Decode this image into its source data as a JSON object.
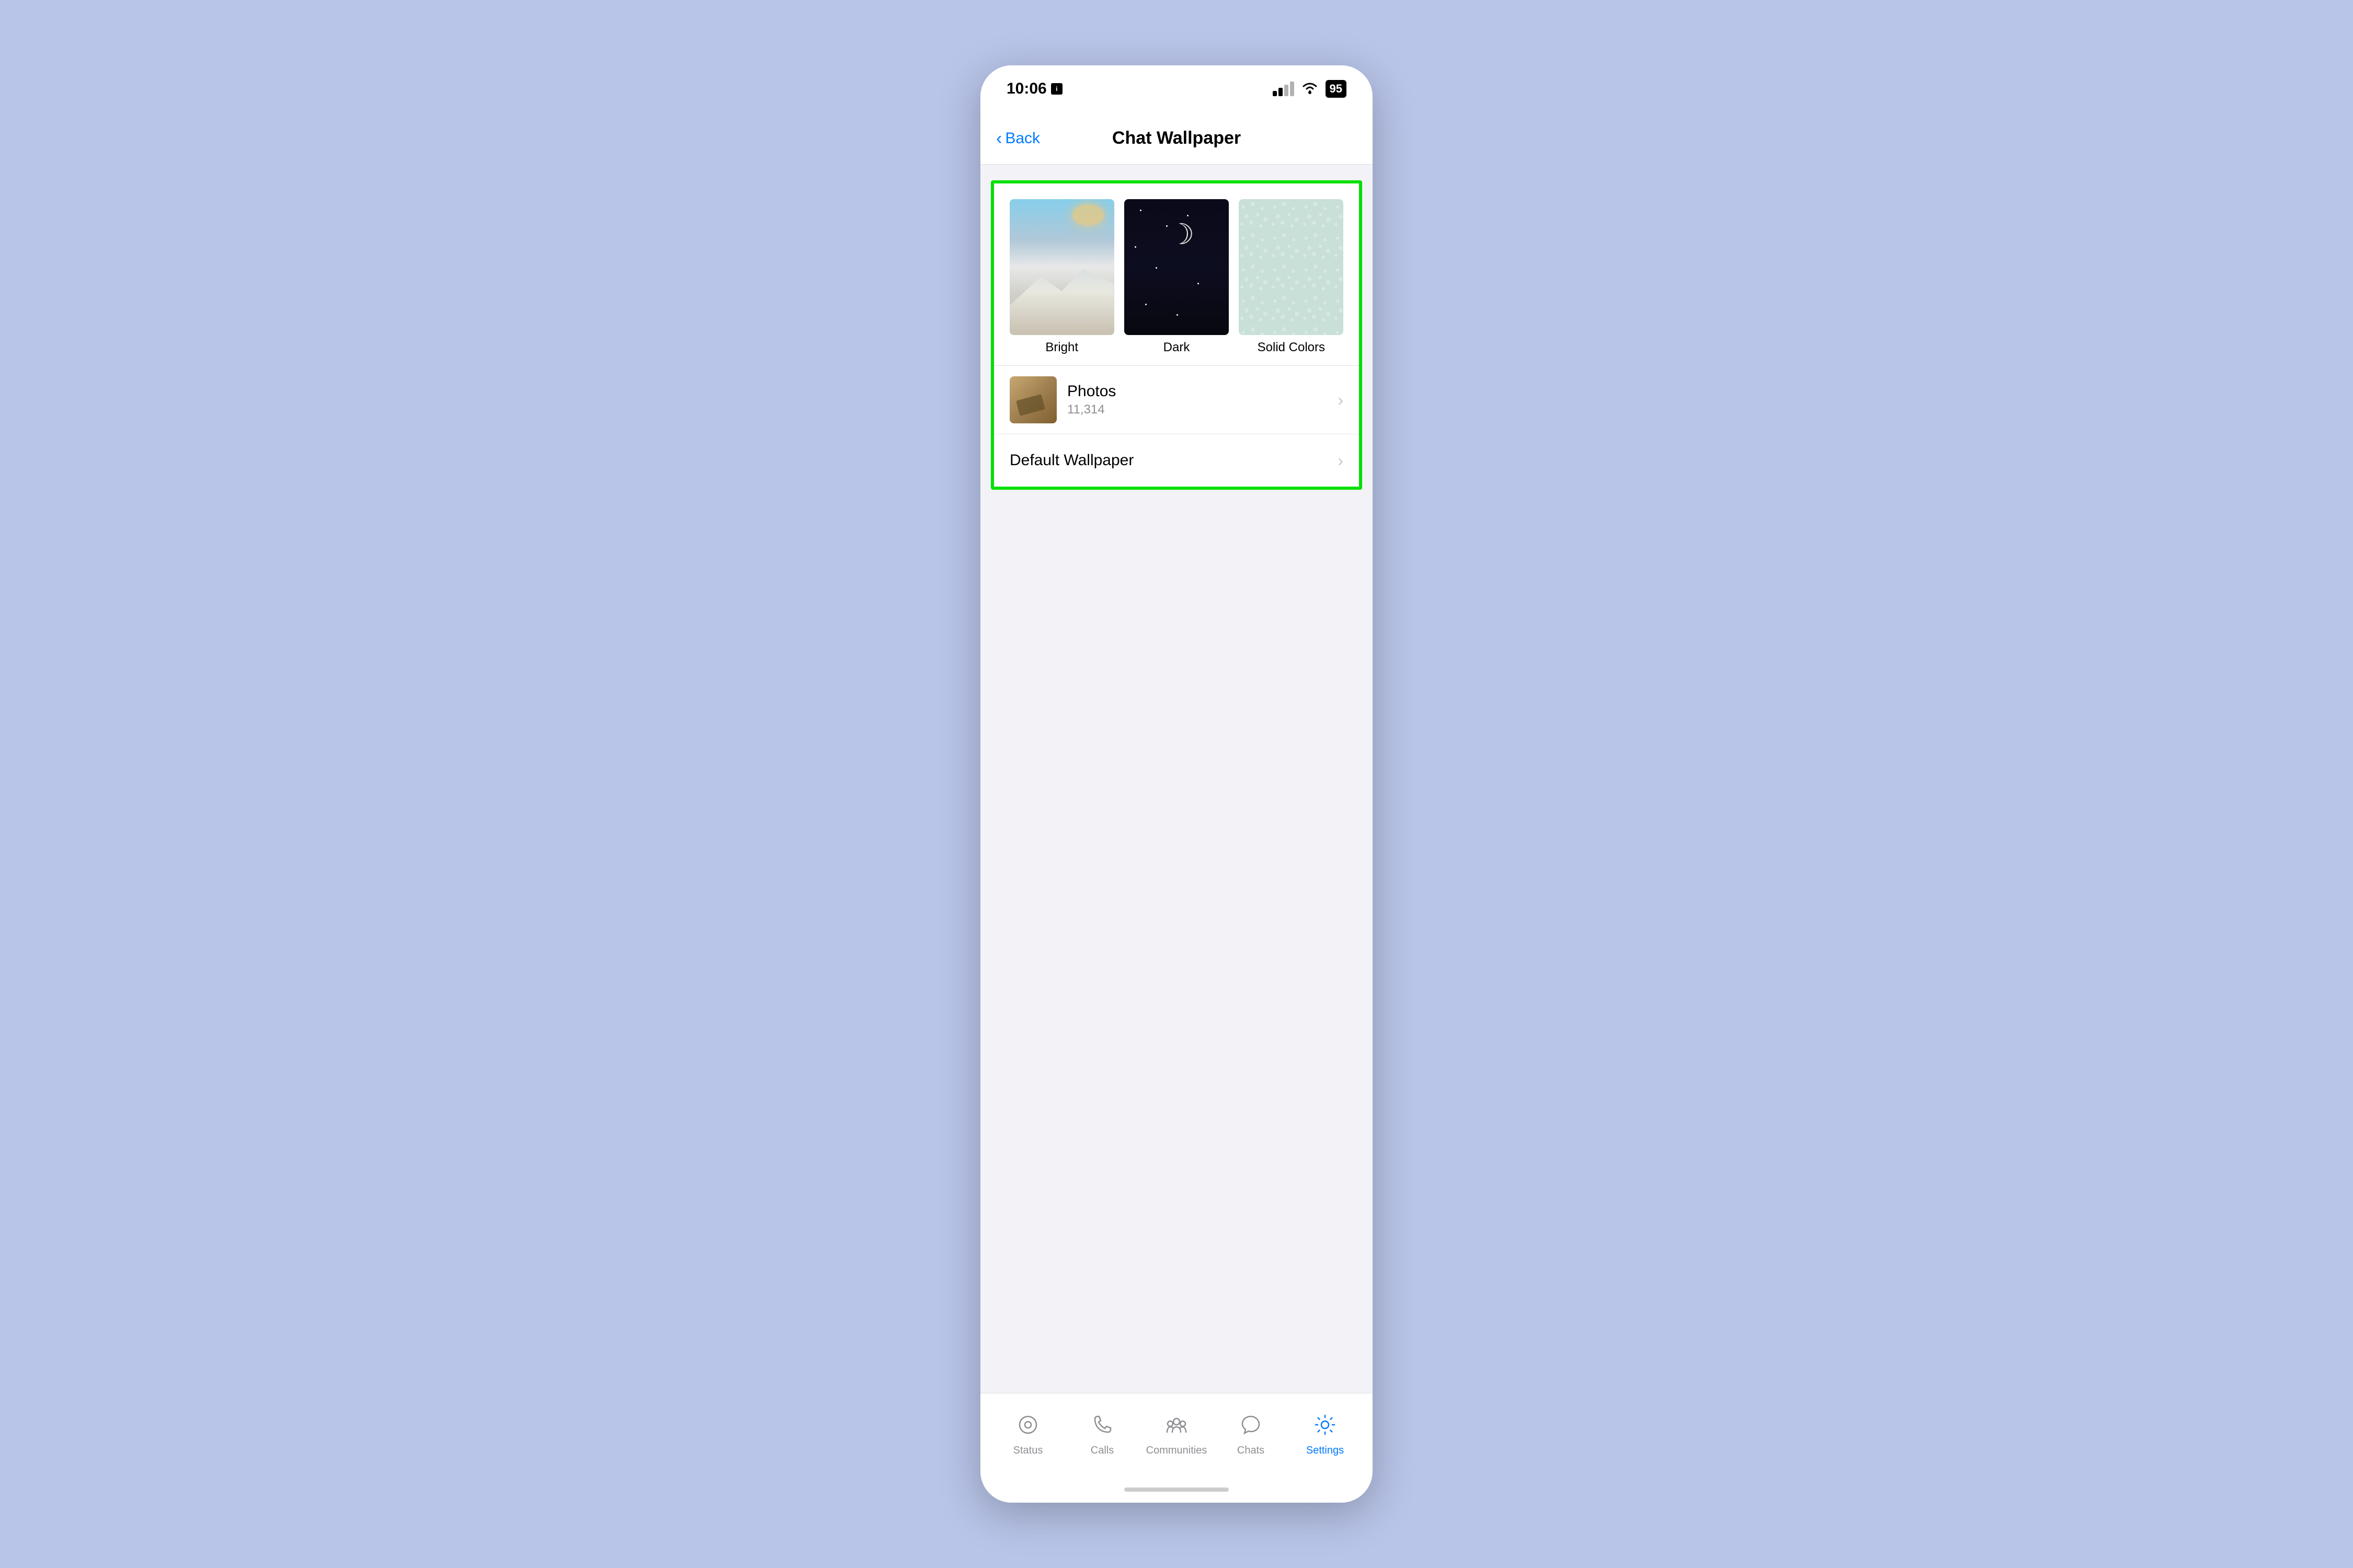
{
  "statusBar": {
    "time": "10:06",
    "battery": "95"
  },
  "navBar": {
    "backLabel": "Back",
    "title": "Chat Wallpaper"
  },
  "wallpaperOptions": {
    "items": [
      {
        "id": "bright",
        "label": "Bright"
      },
      {
        "id": "dark",
        "label": "Dark"
      },
      {
        "id": "solid",
        "label": "Solid Colors"
      }
    ]
  },
  "listItems": [
    {
      "id": "photos",
      "title": "Photos",
      "subtitle": "11,314",
      "hasChevron": true
    },
    {
      "id": "default-wallpaper",
      "title": "Default Wallpaper",
      "hasChevron": true
    }
  ],
  "tabBar": {
    "items": [
      {
        "id": "status",
        "label": "Status",
        "active": false
      },
      {
        "id": "calls",
        "label": "Calls",
        "active": false
      },
      {
        "id": "communities",
        "label": "Communities",
        "active": false
      },
      {
        "id": "chats",
        "label": "Chats",
        "active": false
      },
      {
        "id": "settings",
        "label": "Settings",
        "active": true
      }
    ]
  }
}
